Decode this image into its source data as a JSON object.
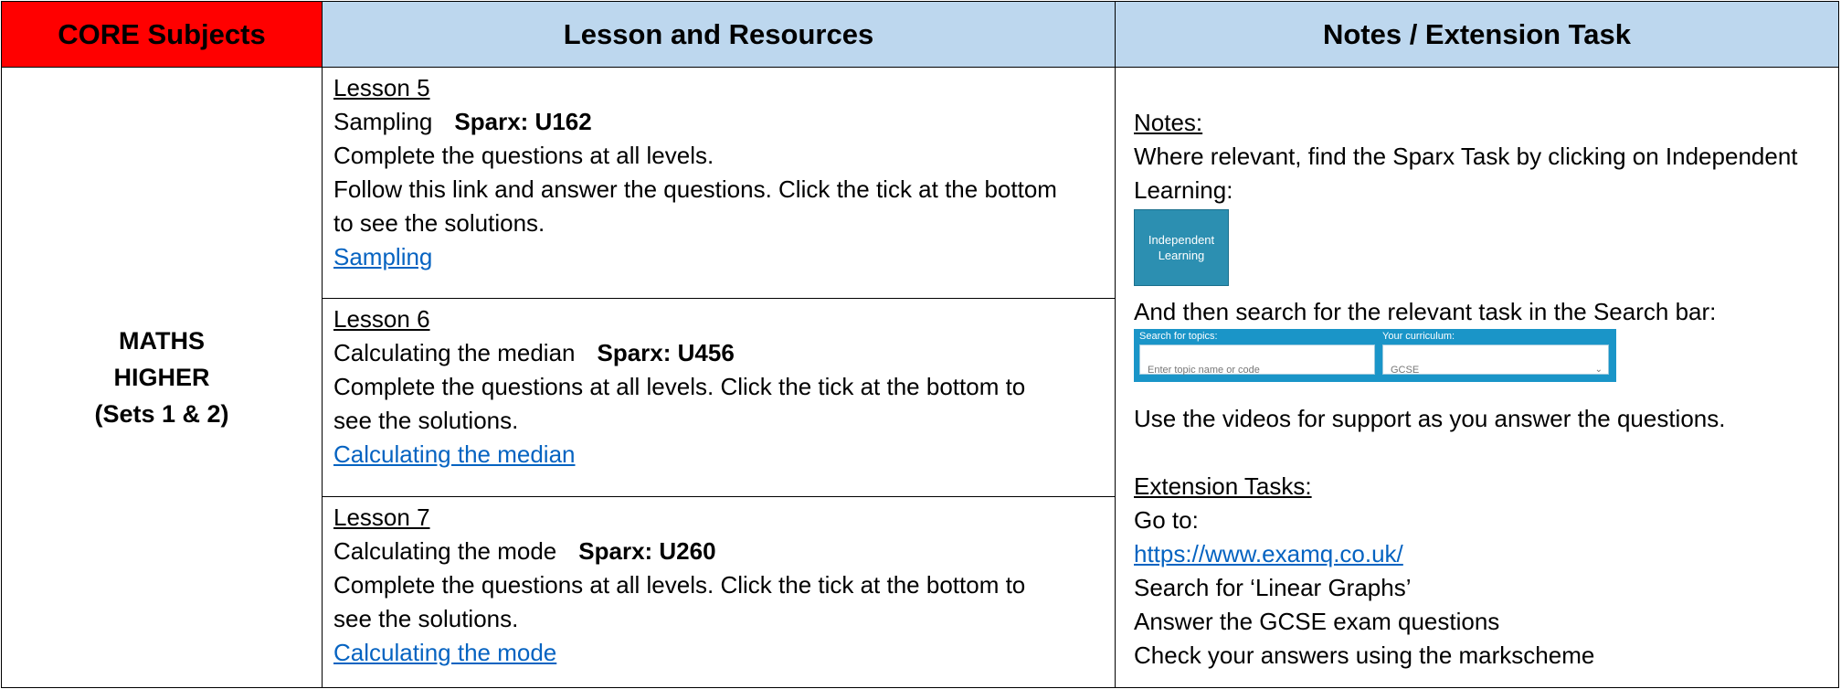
{
  "header": {
    "col1": "CORE Subjects",
    "col2": "Lesson and Resources",
    "col3": "Notes / Extension Task"
  },
  "subject": {
    "line1": "MATHS",
    "line2": "HIGHER",
    "line3": "(Sets 1 & 2)"
  },
  "lessons": [
    {
      "title": "Lesson 5",
      "topic": "Sampling",
      "sparx": "Sparx: U162",
      "lines": [
        "Complete the questions at all levels.",
        "Follow this link and answer the questions. Click the tick at the bottom",
        "to see the solutions."
      ],
      "link": "Sampling"
    },
    {
      "title": "Lesson 6",
      "topic": "Calculating the median",
      "sparx": "Sparx: U456",
      "lines": [
        "Complete the questions at all levels. Click the tick at the bottom to",
        "see the solutions."
      ],
      "link": "Calculating the median"
    },
    {
      "title": "Lesson 7",
      "topic": "Calculating the mode",
      "sparx": "Sparx: U260",
      "lines": [
        "Complete the questions at all levels. Click the tick at the bottom to",
        "see the solutions."
      ],
      "link": "Calculating the mode"
    }
  ],
  "notes": {
    "heading": "Notes:",
    "line1": "Where relevant, find the Sparx Task by clicking on Independent",
    "line2": "Learning:",
    "button": {
      "line1": "Independent",
      "line2": "Learning"
    },
    "search_line": "And then search for the relevant task in the Search bar:",
    "search_widget": {
      "topics_label": "Search for topics:",
      "topics_placeholder": "Enter topic name or code",
      "curriculum_label": "Your curriculum:",
      "curriculum_value": "GCSE"
    },
    "videos_line": "Use the videos for support as you answer the questions.",
    "extension_heading": "Extension Tasks:",
    "goto": "Go to:",
    "url": "https://www.examq.co.uk/",
    "search_for": "Search for ‘Linear Graphs’",
    "answer": "Answer the GCSE exam questions",
    "check": "Check your answers using the markscheme"
  },
  "colors": {
    "header_red": "#ff0000",
    "header_blue": "#bdd7ee",
    "link": "#0563c1",
    "sparx_button": "#2c8fb1",
    "sparx_search_bar": "#1a95c8"
  }
}
